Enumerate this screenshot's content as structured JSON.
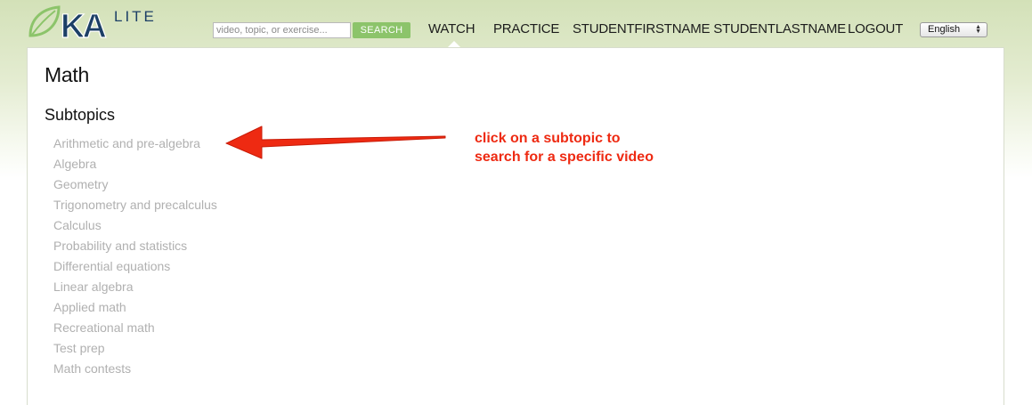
{
  "logo": {
    "brand": "KA",
    "suffix": "LITE"
  },
  "search": {
    "placeholder": "video, topic, or exercise...",
    "button_label": "SEARCH"
  },
  "nav": {
    "watch": "WATCH",
    "practice": "PRACTICE",
    "user": "STUDENTFIRSTNAME STUDENTLASTNAME",
    "logout": "LOGOUT"
  },
  "language": {
    "selected": "English"
  },
  "main": {
    "title": "Math",
    "subtopics_heading": "Subtopics",
    "subtopics": [
      "Arithmetic and pre-algebra",
      "Algebra",
      "Geometry",
      "Trigonometry and precalculus",
      "Calculus",
      "Probability and statistics",
      "Differential equations",
      "Linear algebra",
      "Applied math",
      "Recreational math",
      "Test prep",
      "Math contests"
    ]
  },
  "annotation": {
    "line1": "click on a subtopic to",
    "line2": "search for a specific video",
    "color": "#ee2a12"
  },
  "colors": {
    "accent_green": "#8cc46a",
    "logo_blue": "#1c3f66",
    "subtopic_gray": "#b0b0b0"
  }
}
